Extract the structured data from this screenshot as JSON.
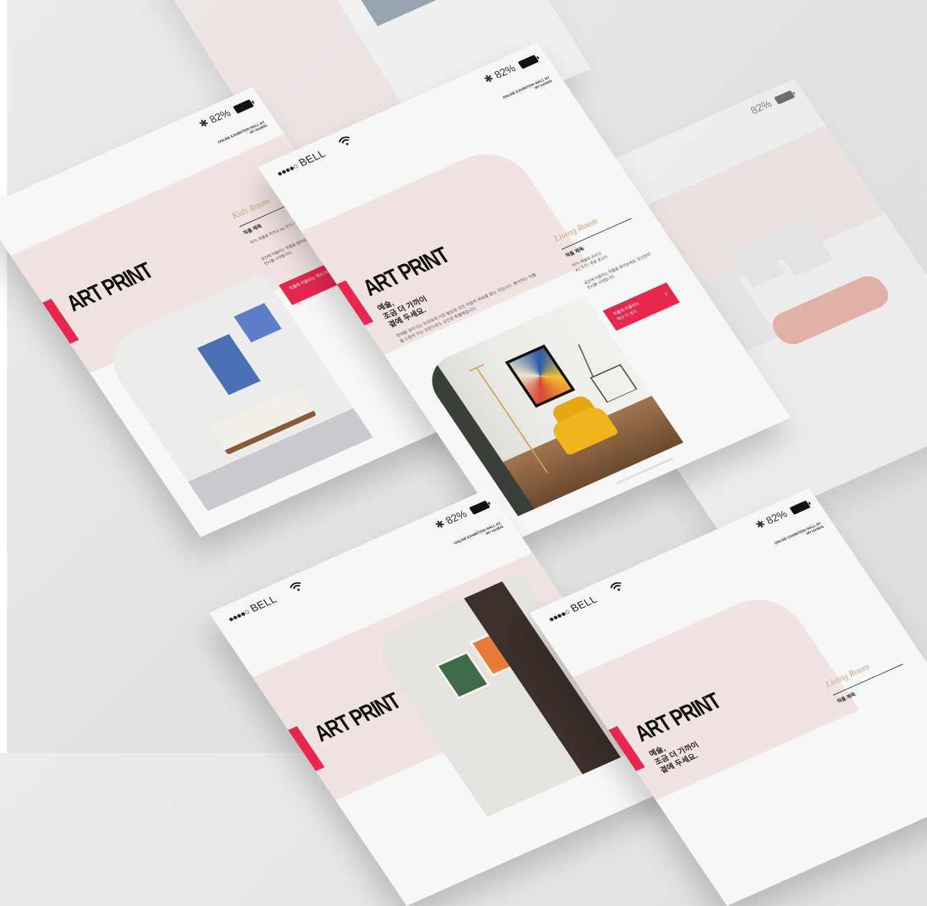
{
  "status_bar": {
    "carrier_dots": "●●●●○",
    "carrier": "BELL",
    "battery": "82%"
  },
  "brand": "ONLINE EXHIBITION WALL\nBY MY HANDS",
  "app": {
    "title": "ART PRINT",
    "subtitle": "예술,\n조금 더 가까이\n곁에 두세요.",
    "body": "현대를 살아가는 우리에게 가장 필요한 것은 마음의 여유를 찾는 것입니다. 좋아하는 작품을 소중히 두는 것만으로도 공간은 특별해집니다.",
    "room_label": "Living Room",
    "kids_room_label": "Kids Room",
    "spec_title": "작품 제목",
    "spec_text": "작가: 파블로 피카소\nA1 크기 / 무광 포스터",
    "spec_text2": "공간에 어울리는 작품을 찾아보세요. 당신만의 전시를 시작합니다.",
    "cta_label": "작품에 어울리는\n액자 더 보기",
    "cta_arrow": "›"
  },
  "colors": {
    "accent": "#e8274f",
    "pink": "#f0e3e1",
    "gold": "#c9a07a"
  },
  "icons": [
    "wifi-icon",
    "bluetooth-icon",
    "battery-icon",
    "arrow-right-icon"
  ]
}
